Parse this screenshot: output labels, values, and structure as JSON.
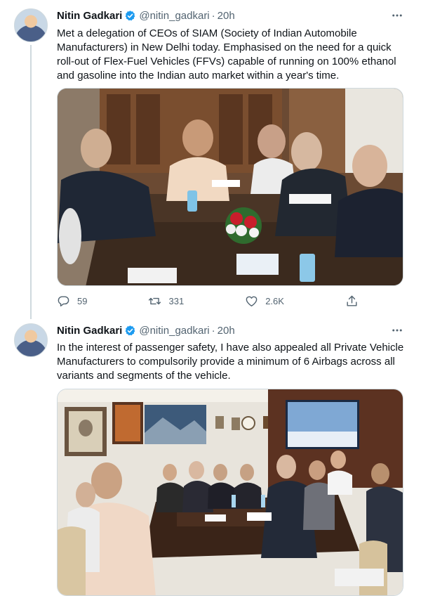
{
  "tweets": [
    {
      "author_name": "Nitin Gadkari",
      "handle": "@nitin_gadkari",
      "separator": "·",
      "time": "20h",
      "text": "Met a delegation of CEOs of SIAM (Society of Indian Automobile Manufacturers) in New Delhi today. Emphasised on the need for a quick roll-out of Flex-Fuel Vehicles (FFVs) capable of running on 100% ethanol and gasoline into the Indian auto market within a year's time.",
      "reply_count": "59",
      "retweet_count": "331",
      "like_count": "2.6K"
    },
    {
      "author_name": "Nitin Gadkari",
      "handle": "@nitin_gadkari",
      "separator": "·",
      "time": "20h",
      "text": "In the interest of passenger safety, I have also appealed all Private Vehicle Manufacturers to compulsorily provide a minimum of 6 Airbags across all variants and segments of the vehicle."
    }
  ],
  "icons": {
    "verified": "verified-badge-icon",
    "more": "more-options-icon",
    "reply": "reply-icon",
    "retweet": "retweet-icon",
    "like": "like-icon",
    "share": "share-icon"
  },
  "colors": {
    "accent": "#1d9bf0",
    "text_primary": "#0f1419",
    "text_secondary": "#536471",
    "border": "#cfd9de"
  }
}
